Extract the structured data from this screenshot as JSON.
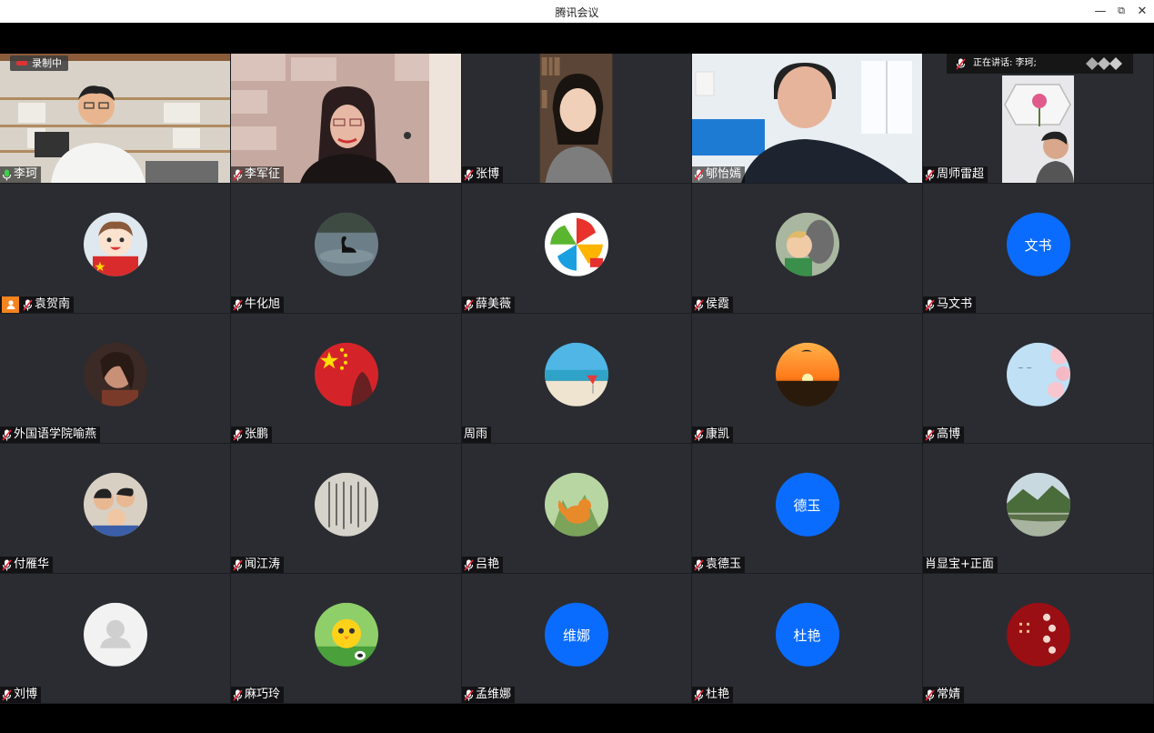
{
  "window": {
    "title": "腾讯会议"
  },
  "recording": {
    "label": "录制中"
  },
  "speaking": {
    "label": "正在讲话: 李珂;"
  },
  "colors": {
    "accent": "#0a6cff",
    "tile_bg": "#2a2c31",
    "host_badge": "#f5831f"
  },
  "participants": [
    {
      "name": "李珂",
      "mic": "active",
      "kind": "video",
      "theme": "bookshelf"
    },
    {
      "name": "李军征",
      "mic": "muted",
      "kind": "video",
      "theme": "stonewall"
    },
    {
      "name": "张博",
      "mic": "muted",
      "kind": "video",
      "theme": "narrow-dark"
    },
    {
      "name": "郇怡嫣",
      "mic": "muted",
      "kind": "video",
      "theme": "bright-room"
    },
    {
      "name": "周师雷超",
      "mic": "muted",
      "kind": "video",
      "theme": "narrow-light"
    },
    {
      "name": "袁贺南",
      "mic": "muted",
      "kind": "avatar",
      "theme": "cartoon-boy",
      "host": true
    },
    {
      "name": "牛化旭",
      "mic": "muted",
      "kind": "avatar",
      "theme": "swan-lake"
    },
    {
      "name": "薛美薇",
      "mic": "muted",
      "kind": "avatar",
      "theme": "pinwheel"
    },
    {
      "name": "侯霞",
      "mic": "muted",
      "kind": "avatar",
      "theme": "child-horse"
    },
    {
      "name": "马文书",
      "mic": "muted",
      "kind": "text",
      "avatar_text": "文书"
    },
    {
      "name": "外国语学院喻燕",
      "mic": "muted",
      "kind": "avatar",
      "theme": "portrait-warm"
    },
    {
      "name": "张鹏",
      "mic": "muted",
      "kind": "avatar",
      "theme": "china-flag"
    },
    {
      "name": "周雨",
      "mic": "none",
      "kind": "avatar",
      "theme": "beach"
    },
    {
      "name": "康凯",
      "mic": "muted",
      "kind": "avatar",
      "theme": "sunset"
    },
    {
      "name": "高博",
      "mic": "muted",
      "kind": "avatar",
      "theme": "blossom"
    },
    {
      "name": "付雁华",
      "mic": "muted",
      "kind": "avatar",
      "theme": "family"
    },
    {
      "name": "闻江涛",
      "mic": "muted",
      "kind": "avatar",
      "theme": "calligraphy"
    },
    {
      "name": "吕艳",
      "mic": "muted",
      "kind": "avatar",
      "theme": "fox"
    },
    {
      "name": "袁德玉",
      "mic": "muted",
      "kind": "text",
      "avatar_text": "德玉"
    },
    {
      "name": "肖显宝+正面",
      "mic": "none",
      "kind": "avatar",
      "theme": "valley"
    },
    {
      "name": "刘博",
      "mic": "muted",
      "kind": "avatar",
      "theme": "default-user"
    },
    {
      "name": "麻巧玲",
      "mic": "muted",
      "kind": "avatar",
      "theme": "chick"
    },
    {
      "name": "孟维娜",
      "mic": "muted",
      "kind": "text",
      "avatar_text": "维娜"
    },
    {
      "name": "杜艳",
      "mic": "muted",
      "kind": "text",
      "avatar_text": "杜艳"
    },
    {
      "name": "常婧",
      "mic": "muted",
      "kind": "avatar",
      "theme": "red-pigs"
    }
  ]
}
